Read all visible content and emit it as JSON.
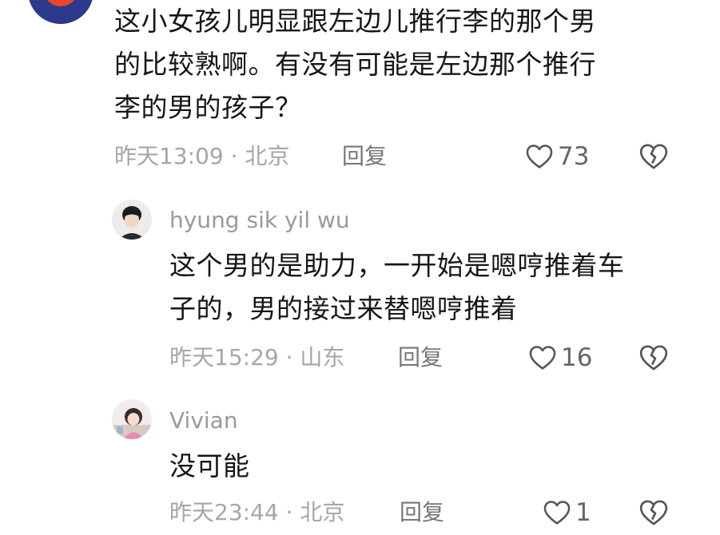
{
  "comments": [
    {
      "text_lines": [
        "这小女孩儿明显跟左边儿推行李的那个男",
        "的比较熟啊。有没有可能是左边那个推行",
        "李的男的孩子？"
      ],
      "time_location": "昨天13:09 · 北京",
      "reply_label": "回复",
      "likes": "73"
    }
  ],
  "replies": [
    {
      "username": "hyung sik yil wu",
      "text_lines": [
        "这个男的是助力，一开始是嗯哼推着车",
        "子的，男的接过来替嗯哼推着"
      ],
      "time_location": "昨天15:29 · 山东",
      "reply_label": "回复",
      "likes": "16"
    },
    {
      "username": "Vivian",
      "text_lines": [
        "没可能"
      ],
      "time_location": "昨天23:44 · 北京",
      "reply_label": "回复",
      "likes": "1"
    }
  ],
  "icons": {
    "like": "heart-outline-icon",
    "dislike": "broken-heart-icon"
  },
  "colors": {
    "text": "#161616",
    "meta": "#a6a6a6",
    "icon": "#555555"
  }
}
